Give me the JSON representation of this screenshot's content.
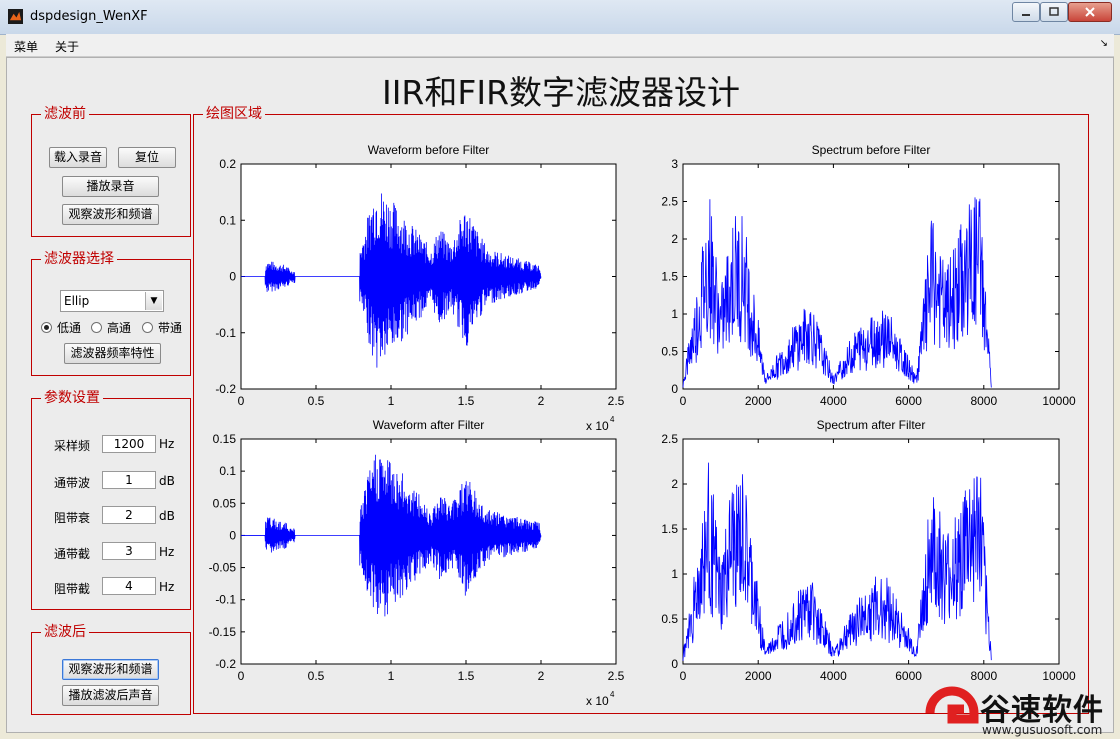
{
  "window": {
    "title": "dspdesign_WenXF"
  },
  "menubar": {
    "items": [
      "菜单",
      "关于"
    ]
  },
  "main_title": "IIR和FIR数字滤波器设计",
  "panels": {
    "before": {
      "title": "滤波前",
      "load_btn": "载入录音",
      "reset_btn": "复位",
      "play_btn": "播放录音",
      "view_btn": "观察波形和频谱"
    },
    "filter": {
      "title": "滤波器选择",
      "select_value": "Ellip",
      "radio_low": "低通",
      "radio_high": "高通",
      "radio_band": "带通",
      "selected": "低通",
      "freq_btn": "滤波器频率特性"
    },
    "params": {
      "title": "参数设置",
      "rows": [
        {
          "label": "采样频",
          "value": "1200",
          "unit": "Hz"
        },
        {
          "label": "通带波",
          "value": "1",
          "unit": "dB"
        },
        {
          "label": "阻带衰",
          "value": "2",
          "unit": "dB"
        },
        {
          "label": "通带截",
          "value": "3",
          "unit": "Hz"
        },
        {
          "label": "阻带截",
          "value": "4",
          "unit": "Hz"
        }
      ]
    },
    "after": {
      "title": "滤波后",
      "view_btn": "观察波形和频谱",
      "play_btn": "播放滤波后声音"
    },
    "plot_area": {
      "title": "绘图区域"
    }
  },
  "watermark": {
    "name": "谷速软件",
    "url": "www.gusuosoft.com"
  },
  "colors": {
    "accent": "#c00000",
    "series": "#0000ff"
  },
  "chart_data": [
    {
      "type": "line",
      "title": "Waveform before Filter",
      "xlim": [
        0,
        25000
      ],
      "ylim": [
        -0.2,
        0.2
      ],
      "xticks": [
        "0",
        "0.5",
        "1",
        "1.5",
        "2",
        "2.5"
      ],
      "yticks": [
        "-0.2",
        "-0.1",
        "0",
        "0.1",
        "0.2"
      ],
      "x_multiplier": "x 10",
      "x_exponent": "4",
      "series": [
        {
          "x": [
            1600,
            1700,
            3000,
            3400,
            8000,
            9000,
            10000,
            12700,
            13200,
            14000,
            15000,
            15800,
            16500,
            19900,
            20000
          ],
          "env": [
            0.02,
            0.03,
            0.02,
            0.01,
            0.06,
            0.17,
            0.14,
            0.05,
            0.09,
            0.06,
            0.13,
            0.08,
            0.05,
            0.02,
            0.0
          ]
        }
      ]
    },
    {
      "type": "line",
      "title": "Spectrum before Filter",
      "xlim": [
        0,
        10000
      ],
      "ylim": [
        0,
        3
      ],
      "xticks": [
        "0",
        "2000",
        "4000",
        "6000",
        "8000",
        "10000"
      ],
      "yticks": [
        "0",
        "0.5",
        "1",
        "1.5",
        "2",
        "2.5",
        "3"
      ],
      "series": [
        {
          "x": [
            0,
            400,
            700,
            1000,
            1300,
            1600,
            2200,
            3000,
            3400,
            4000,
            4600,
            5000,
            5400,
            6200,
            6600,
            7000,
            7600,
            7900,
            8200
          ],
          "env": [
            0.1,
            1.5,
            2.7,
            1.3,
            2.3,
            2.4,
            0.15,
            0.9,
            1.2,
            0.15,
            0.8,
            1.0,
            1.1,
            0.15,
            2.3,
            1.6,
            2.5,
            2.7,
            0.1
          ]
        }
      ]
    },
    {
      "type": "line",
      "title": "Waveform after Filter",
      "xlim": [
        0,
        25000
      ],
      "ylim": [
        -0.2,
        0.15
      ],
      "xticks": [
        "0",
        "0.5",
        "1",
        "1.5",
        "2",
        "2.5"
      ],
      "yticks": [
        "-0.2",
        "-0.15",
        "-0.1",
        "-0.05",
        "0",
        "0.05",
        "0.1",
        "0.15"
      ],
      "x_multiplier": "x 10",
      "x_exponent": "4",
      "series": [
        {
          "x": [
            1600,
            1700,
            3000,
            3400,
            8000,
            9000,
            10000,
            12700,
            13200,
            14000,
            15000,
            15800,
            16500,
            19900,
            20000
          ],
          "env": [
            0.02,
            0.03,
            0.02,
            0.01,
            0.05,
            0.14,
            0.12,
            0.04,
            0.07,
            0.05,
            0.1,
            0.06,
            0.04,
            0.02,
            0.0
          ]
        }
      ]
    },
    {
      "type": "line",
      "title": "Spectrum after Filter",
      "xlim": [
        0,
        10000
      ],
      "ylim": [
        0,
        2.5
      ],
      "xticks": [
        "0",
        "2000",
        "4000",
        "6000",
        "8000",
        "10000"
      ],
      "yticks": [
        "0",
        "0.5",
        "1",
        "1.5",
        "2",
        "2.5"
      ],
      "series": [
        {
          "x": [
            0,
            400,
            700,
            1000,
            1300,
            1600,
            2200,
            3000,
            3400,
            4000,
            4600,
            5000,
            5400,
            6200,
            6600,
            7000,
            7600,
            7900,
            8200
          ],
          "env": [
            0.1,
            1.3,
            2.3,
            1.1,
            2.0,
            2.1,
            0.15,
            0.8,
            1.0,
            0.15,
            0.7,
            0.9,
            1.0,
            0.15,
            2.0,
            1.4,
            2.1,
            2.2,
            0.1
          ]
        }
      ]
    }
  ]
}
